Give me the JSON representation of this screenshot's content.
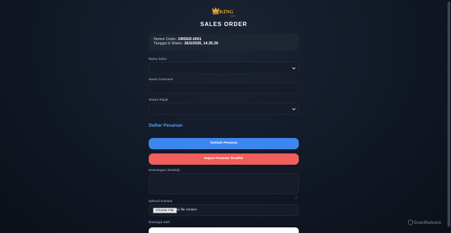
{
  "brand": {
    "logo_text": "KING",
    "logo_subtext": "BOKKET"
  },
  "page": {
    "title": "SALES ORDER"
  },
  "order_info": {
    "number_label": "Nomor Order:",
    "number_value": "ORDER-0001",
    "datetime_label": "Tanggal & Waktu:",
    "datetime_value": "26/2/2026, 14.35.39"
  },
  "form": {
    "sales": {
      "label": "Nama Sales",
      "value": ""
    },
    "customer": {
      "label": "Nama Customer",
      "value": ""
    },
    "tax_status": {
      "label": "Status Pajak",
      "value": ""
    },
    "notes": {
      "label": "Keterangan (Global)",
      "value": ""
    },
    "upload": {
      "label": "Upload Gambar",
      "button_label": "Choose File",
      "status_text": "No file chosen"
    },
    "approved_by": {
      "label": "Disetujui oleh",
      "value": ""
    }
  },
  "order_items": {
    "section_title": "Daftar Pesanan",
    "add_button_label": "Tambah Pesanan",
    "remove_last_button_label": "Hapus Pesanan Terakhir"
  },
  "watermark": {
    "text": "ScanMalware"
  },
  "colors": {
    "accent_blue": "#3d86ee",
    "danger_red": "#f05f5c",
    "section_title_blue": "#5b9cf0",
    "logo_gold": "#e0a52c"
  }
}
